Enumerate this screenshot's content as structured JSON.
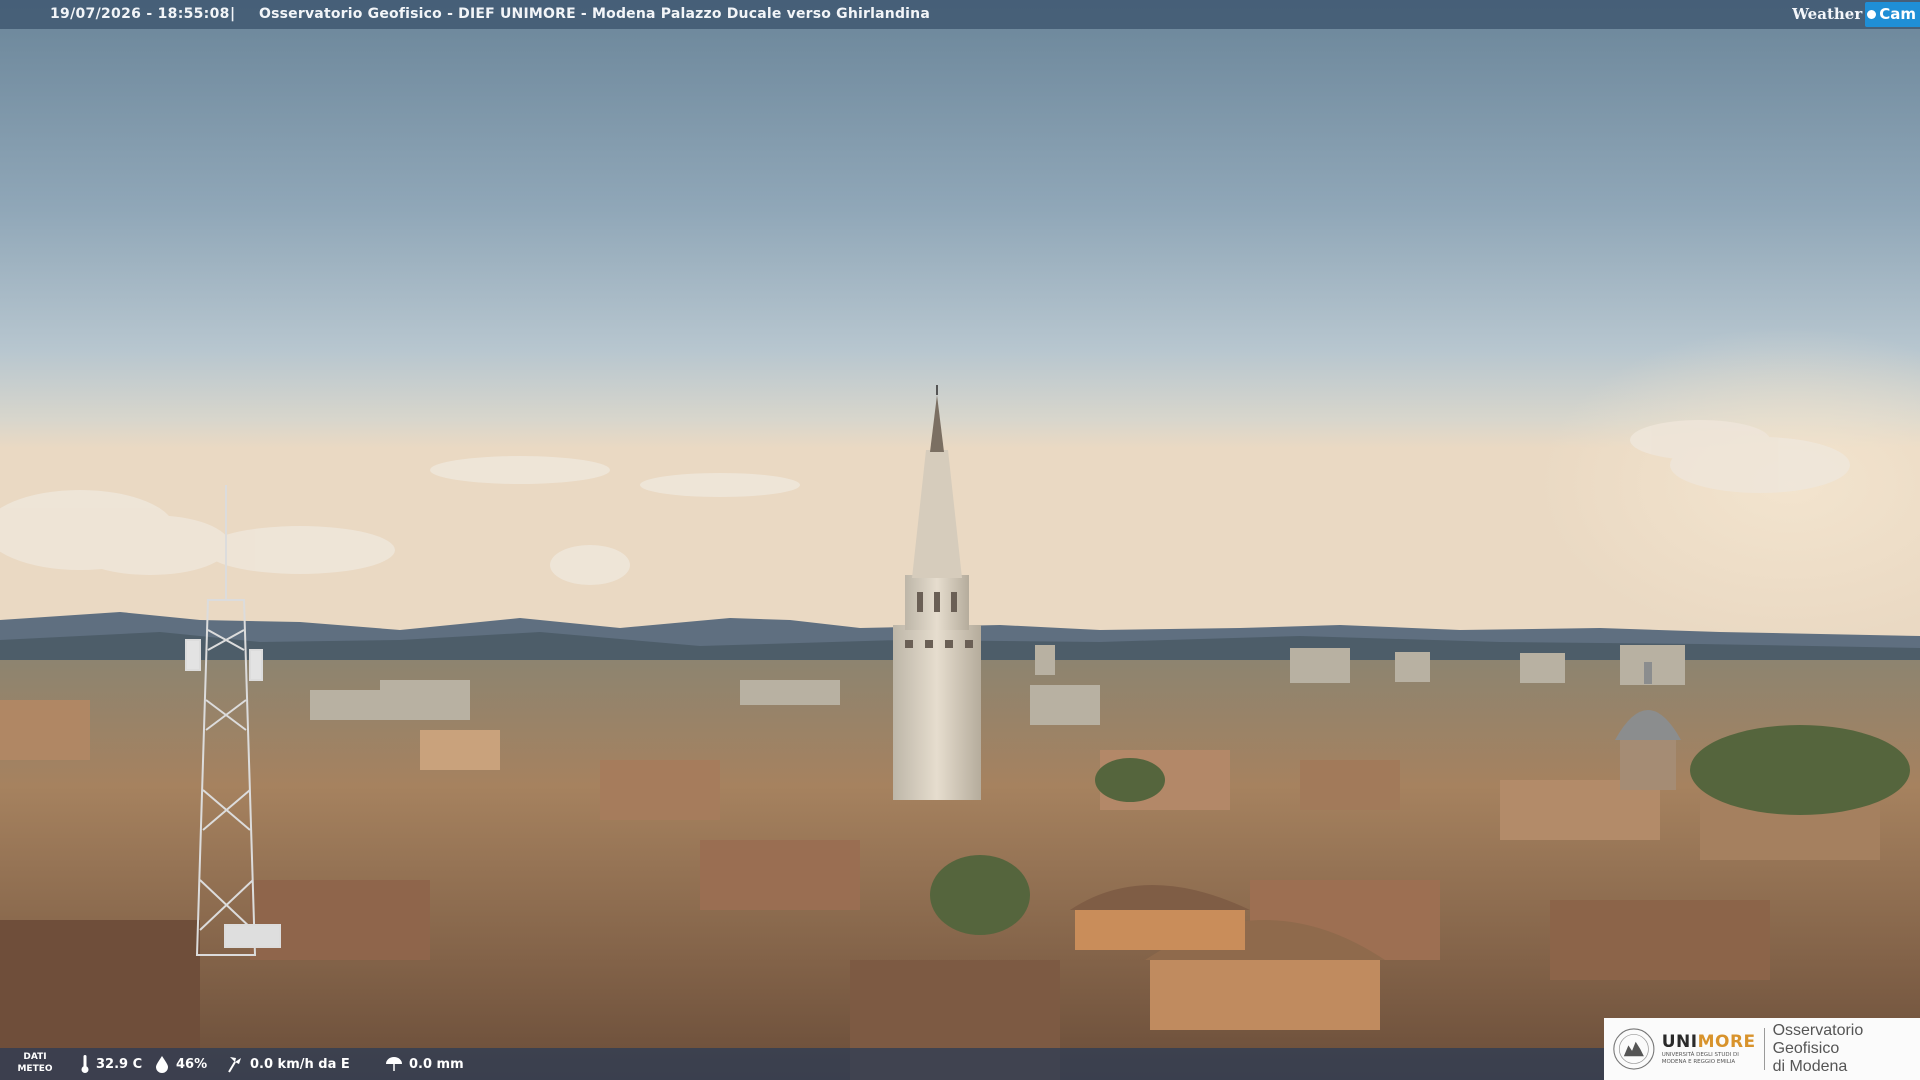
{
  "header": {
    "timestamp": "19/07/2026 - 18:55:08",
    "separator": "|",
    "title": "Osservatorio Geofisico - DIEF UNIMORE - Modena Palazzo Ducale verso Ghirlandina",
    "brand_left": "Weather",
    "brand_right": "Cam"
  },
  "weather": {
    "label_line1": "DATI",
    "label_line2": "METEO",
    "temperature": "32.9 C",
    "humidity": "46%",
    "wind": "0.0 km/h da E",
    "rain": "0.0 mm",
    "icons": [
      "thermometer-icon",
      "humidity-icon",
      "wind-icon",
      "rain-icon"
    ]
  },
  "logo": {
    "uni_part1": "UNI",
    "uni_part2": "MORE",
    "uni_sub_line1": "UNIVERSITÀ DEGLI STUDI DI",
    "uni_sub_line2": "MODENA E REGGIO EMILIA",
    "observatory_line1": "Osservatorio Geofisico",
    "observatory_line2": "di Modena"
  },
  "colors": {
    "sky_top": "#6f8ba1",
    "sky_horizon": "#e9d9c0",
    "roofs": "#8b6a4f",
    "brand_blue": "#1f8fd6",
    "uni_orange": "#d8932c"
  }
}
